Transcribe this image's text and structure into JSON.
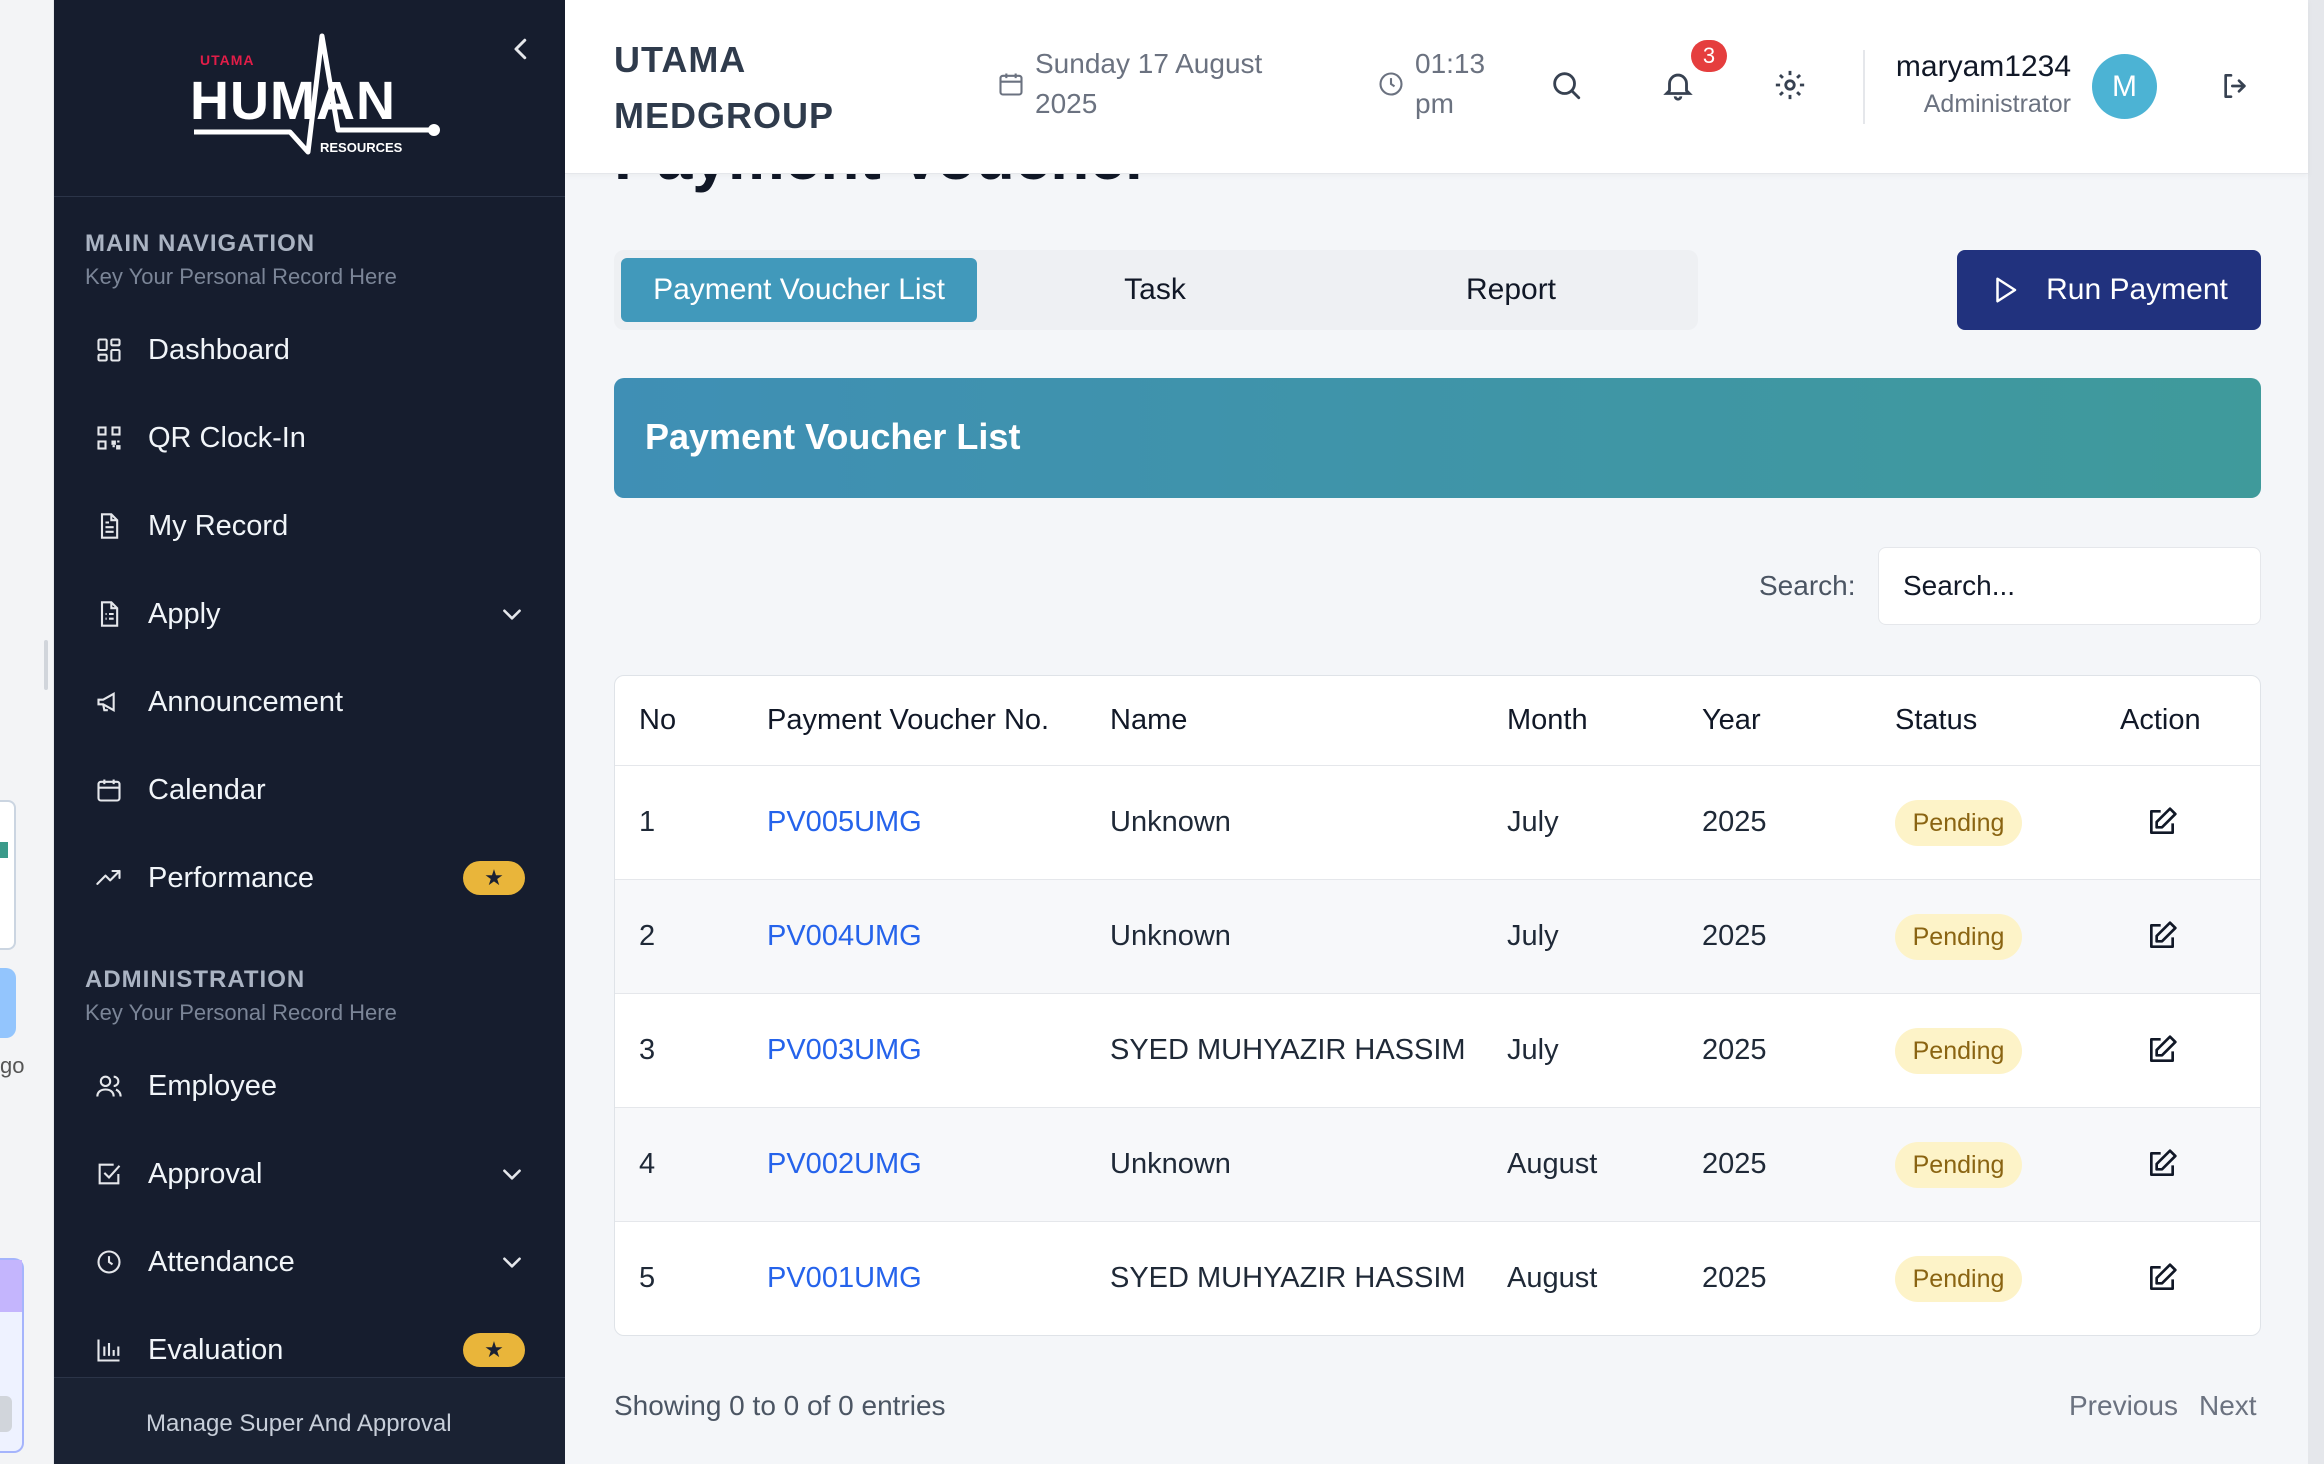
{
  "background_window": {
    "partial_text": "go"
  },
  "logo": {
    "top": "UTAMA",
    "main": "HUMAN",
    "bottom": "RESOURCES"
  },
  "sidebar": {
    "main_title": "MAIN NAVIGATION",
    "main_sub": "Key Your Personal Record Here",
    "main_items": [
      {
        "label": "Dashboard",
        "icon": "dashboard-icon"
      },
      {
        "label": "QR Clock-In",
        "icon": "qr-icon"
      },
      {
        "label": "My Record",
        "icon": "document-icon"
      },
      {
        "label": "Apply",
        "icon": "apply-icon",
        "expandable": true
      },
      {
        "label": "Announcement",
        "icon": "megaphone-icon"
      },
      {
        "label": "Calendar",
        "icon": "calendar-icon"
      },
      {
        "label": "Performance",
        "icon": "trending-icon",
        "badge": "star"
      }
    ],
    "admin_title": "ADMINISTRATION",
    "admin_sub": "Key Your Personal Record Here",
    "admin_items": [
      {
        "label": "Employee",
        "icon": "users-icon"
      },
      {
        "label": "Approval",
        "icon": "checkbox-icon",
        "expandable": true
      },
      {
        "label": "Attendance",
        "icon": "clock-icon",
        "expandable": true
      },
      {
        "label": "Evaluation",
        "icon": "bar-chart-icon",
        "badge": "star"
      }
    ],
    "footer": "Manage Super And Approval"
  },
  "header": {
    "company": "UTAMA\nMEDGROUP",
    "date": "Sunday 17 August\n2025",
    "time": "01:13\npm",
    "notification_count": "3",
    "user_name": "maryam1234",
    "user_role": "Administrator",
    "avatar_letter": "M"
  },
  "page": {
    "title": "Payment Voucher",
    "tabs": [
      "Payment Voucher List",
      "Task",
      "Report"
    ],
    "active_tab": "Payment Voucher List",
    "run_button": "Run Payment",
    "banner": "Payment Voucher List",
    "search_label": "Search:",
    "search_placeholder": "Search..."
  },
  "table": {
    "columns": [
      "No",
      "Payment Voucher No.",
      "Name",
      "Month",
      "Year",
      "Status",
      "Action"
    ],
    "rows": [
      {
        "no": "1",
        "voucher": "PV005UMG",
        "name": "Unknown",
        "month": "July",
        "year": "2025",
        "status": "Pending"
      },
      {
        "no": "2",
        "voucher": "PV004UMG",
        "name": "Unknown",
        "month": "July",
        "year": "2025",
        "status": "Pending"
      },
      {
        "no": "3",
        "voucher": "PV003UMG",
        "name": "SYED MUHYAZIR HASSIM",
        "month": "July",
        "year": "2025",
        "status": "Pending"
      },
      {
        "no": "4",
        "voucher": "PV002UMG",
        "name": "Unknown",
        "month": "August",
        "year": "2025",
        "status": "Pending"
      },
      {
        "no": "5",
        "voucher": "PV001UMG",
        "name": "SYED MUHYAZIR HASSIM",
        "month": "August",
        "year": "2025",
        "status": "Pending"
      }
    ]
  },
  "pagination": {
    "info": "Showing 0 to 0 of 0 entries",
    "previous": "Previous",
    "next": "Next"
  },
  "colors": {
    "sidebar_bg": "#161d2e",
    "active_tab": "#4199bb",
    "run_button": "#21327e",
    "pending_badge": "#fdf3c8",
    "link": "#2563eb",
    "star_badge": "#e9b53a"
  }
}
